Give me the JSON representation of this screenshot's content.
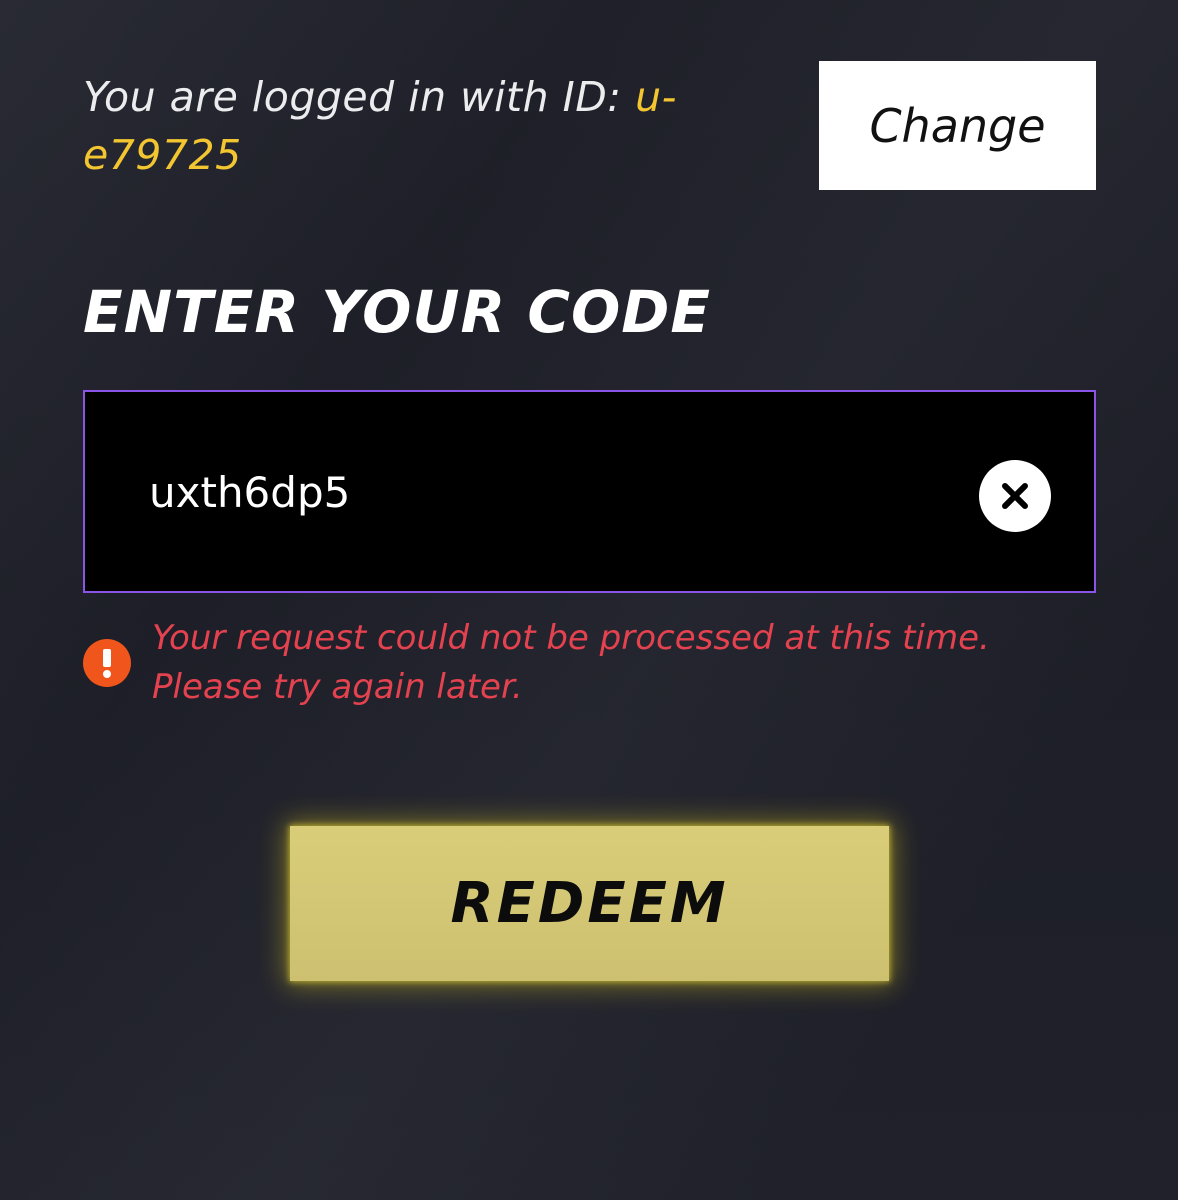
{
  "login": {
    "prefix": "You are logged in with ID: ",
    "user_id": "u-e79725",
    "change_label": "Change"
  },
  "redeem_form": {
    "heading": "ENTER YOUR CODE",
    "code_value": "uxth6dp5",
    "error_message": "Your request could not be processed at this time. Please try again later.",
    "redeem_label": "REDEEM"
  },
  "icons": {
    "clear": "close-circle-icon",
    "error": "exclamation-circle-icon"
  },
  "colors": {
    "user_id": "#f3c531",
    "input_border": "#8b54e8",
    "error_text": "#e4424f",
    "error_icon": "#f0561c",
    "redeem_button": "#d4c875"
  }
}
